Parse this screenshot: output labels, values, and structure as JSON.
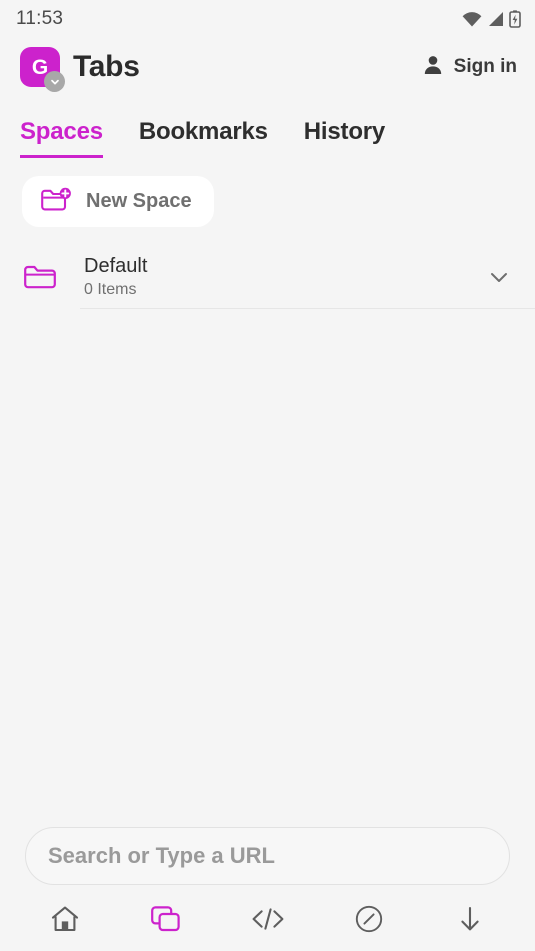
{
  "status_bar": {
    "time": "11:53",
    "icons": [
      "wifi-icon",
      "cellular-signal-icon",
      "battery-charging-icon"
    ]
  },
  "header": {
    "logo_letter": "G",
    "logo_badge_icon": "chevron-down-icon",
    "title": "Tabs",
    "account": {
      "icon": "person-icon",
      "label": "Sign in"
    }
  },
  "tabs": [
    {
      "label": "Spaces",
      "active": true
    },
    {
      "label": "Bookmarks",
      "active": false
    },
    {
      "label": "History",
      "active": false
    }
  ],
  "new_space": {
    "icon": "folder-plus-icon",
    "label": "New Space"
  },
  "spaces": [
    {
      "icon": "folder-icon",
      "name": "Default",
      "item_count": "0 Items",
      "expand_icon": "chevron-down-icon"
    }
  ],
  "search": {
    "placeholder": "Search or Type a URL",
    "value": ""
  },
  "bottom_nav": [
    {
      "icon": "home-icon",
      "active": false
    },
    {
      "icon": "tabs-icon",
      "active": true
    },
    {
      "icon": "code-icon",
      "active": false
    },
    {
      "icon": "block-circle-icon",
      "active": false
    },
    {
      "icon": "download-arrow-icon",
      "active": false
    }
  ],
  "colors": {
    "accent": "#cc22cc",
    "background": "#f5f5f5",
    "text_primary": "#2e2e2e",
    "text_secondary": "#707070",
    "icon_grey": "#5e5e5e",
    "divider": "#e6e6e6"
  }
}
